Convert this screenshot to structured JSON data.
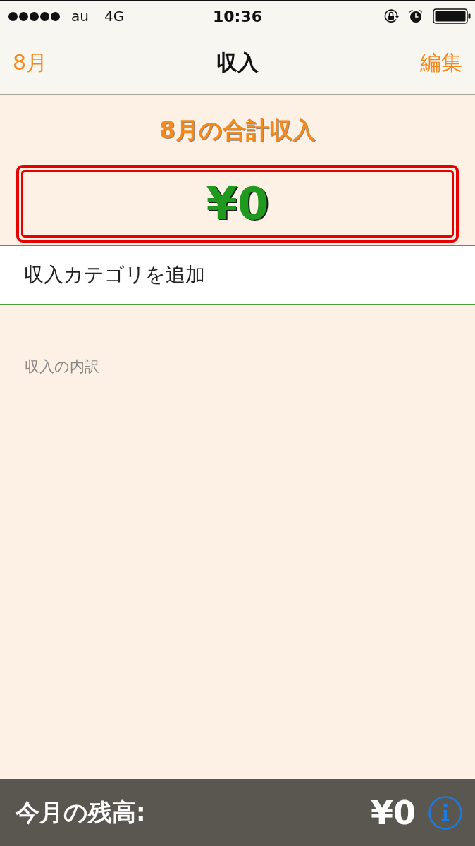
{
  "status_bar": {
    "carrier": "au",
    "network": "4G",
    "time": "10:36"
  },
  "nav_bar": {
    "back": "8月",
    "title": "収入",
    "action": "編集"
  },
  "summary": {
    "title": "8月の合計収入",
    "amount": "¥0"
  },
  "add_row": {
    "label": "収入カテゴリを追加"
  },
  "section_header": {
    "label": "収入の内訳"
  },
  "footer": {
    "label": "今月の残高:",
    "amount": "¥0"
  }
}
